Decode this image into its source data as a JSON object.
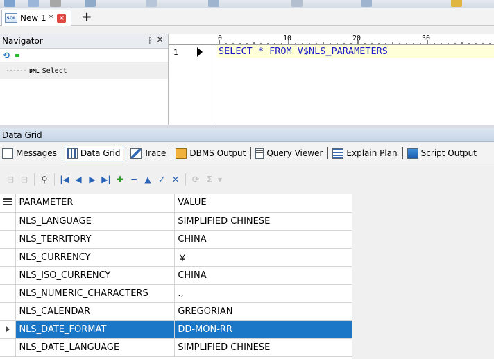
{
  "doc_tab": {
    "icon_text": "SQL",
    "label": "New 1 *",
    "close_icon": "close-icon",
    "add_label": "+"
  },
  "navigator": {
    "title": "Navigator",
    "pin_glyph": "ᛒ",
    "close_glyph": "×",
    "tree_dots": "······",
    "item_badge": "DML",
    "item_label": "Select"
  },
  "editor": {
    "ruler_marks": [
      "0",
      "10",
      "20",
      "30"
    ],
    "line_number": "1",
    "code": "SELECT * FROM V$NLS_PARAMETERS"
  },
  "result_panel": {
    "title": "Data Grid"
  },
  "result_tabs": [
    {
      "label": "Messages",
      "icon": "messages-icon",
      "active": false
    },
    {
      "label": "Data Grid",
      "icon": "grid-icon",
      "active": true
    },
    {
      "label": "Trace",
      "icon": "trace-icon",
      "active": false
    },
    {
      "label": "DBMS Output",
      "icon": "dbms-output-icon",
      "active": false
    },
    {
      "label": "Query Viewer",
      "icon": "query-viewer-icon",
      "active": false
    },
    {
      "label": "Explain Plan",
      "icon": "explain-plan-icon",
      "active": false
    },
    {
      "label": "Script Output",
      "icon": "script-output-icon",
      "active": false
    }
  ],
  "grid_toolbar": {
    "first": "|◀",
    "prev": "◀",
    "next": "▶",
    "last": "▶|",
    "insert": "✚",
    "delete": "━",
    "up": "▲",
    "post": "✓",
    "cancel": "✕",
    "sum": "Σ",
    "dropdown": "▾"
  },
  "grid": {
    "headers": [
      "PARAMETER",
      "VALUE"
    ],
    "rows": [
      [
        "NLS_LANGUAGE",
        "SIMPLIFIED CHINESE"
      ],
      [
        "NLS_TERRITORY",
        "CHINA"
      ],
      [
        "NLS_CURRENCY",
        "￥"
      ],
      [
        "NLS_ISO_CURRENCY",
        "CHINA"
      ],
      [
        "NLS_NUMERIC_CHARACTERS",
        ".,"
      ],
      [
        "NLS_CALENDAR",
        "GREGORIAN"
      ],
      [
        "NLS_DATE_FORMAT",
        "DD-MON-RR"
      ],
      [
        "NLS_DATE_LANGUAGE",
        "SIMPLIFIED CHINESE"
      ]
    ],
    "selected_row": 6
  },
  "colors": {
    "selection": "#1a76c6",
    "code_text": "#1d1dc8",
    "code_bg": "#ffffd8",
    "panel_title_bg": "#c7d5e7"
  }
}
